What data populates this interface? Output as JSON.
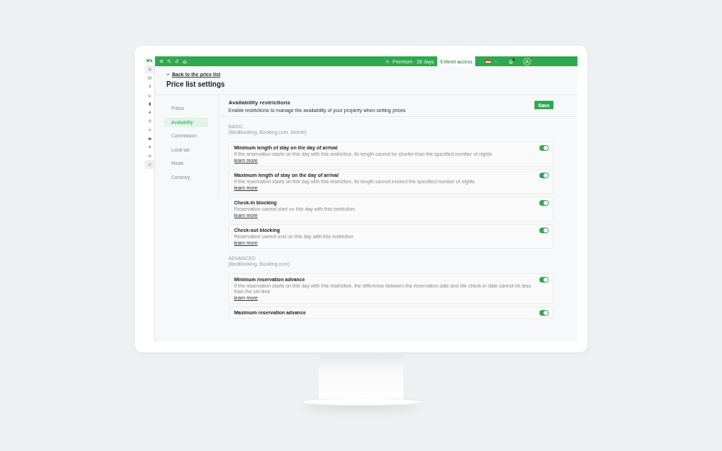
{
  "rail": {
    "items": [
      {
        "selected": true
      },
      {
        "selected": false
      },
      {
        "selected": false
      },
      {
        "selected": false
      },
      {
        "selected": false
      },
      {
        "selected": false
      },
      {
        "selected": false
      },
      {
        "selected": false
      },
      {
        "selected": false
      },
      {
        "selected": false
      },
      {
        "selected": false
      },
      {
        "selected": true
      }
    ]
  },
  "topbar": {
    "premium": "Premium · 28 days",
    "extend_button": "Extend access",
    "avatar": "A"
  },
  "header": {
    "back_link": "Back to the price list",
    "title": "Price list settings"
  },
  "nav": [
    {
      "label": "Prices",
      "selected": false
    },
    {
      "label": "Availability",
      "selected": true
    },
    {
      "label": "Commission",
      "selected": false
    },
    {
      "label": "Local tax",
      "selected": false
    },
    {
      "label": "Meals",
      "selected": false
    },
    {
      "label": "Currency",
      "selected": false
    }
  ],
  "panel": {
    "title": "Availability restrictions",
    "subtitle": "Enable restrictions to manage the availability of your property when setting prices",
    "save_button": "Save"
  },
  "groups": [
    {
      "heading": "BASIC",
      "channels": "(BedBooking, Booking.com, Airbnb)",
      "restrictions": [
        {
          "title": "Minimum length of stay on the day of arrival",
          "description": "If the reservation starts on this day with this restriction, its length cannot be shorter than the specified number of nights",
          "link": "learn more",
          "on": true
        },
        {
          "title": "Maximum length of stay on the day of arrival",
          "description": "If the reservation starts on this day with this restriction, its length cannot exceed the specified number of nights",
          "link": "learn more",
          "on": true
        },
        {
          "title": "Check-in blocking",
          "description": "Reservation cannot start on this day with this restriction",
          "link": "learn more",
          "on": true
        },
        {
          "title": "Check-out blocking",
          "description": "Reservation cannot end on this day with this restriction",
          "link": "learn more",
          "on": true
        }
      ]
    },
    {
      "heading": "ADVANCED",
      "channels": "(BedBooking, Booking.com)",
      "restrictions": [
        {
          "title": "Minimum reservation advance",
          "description": "If the reservation starts on this day with this restriction, the difference between the reservation date and the check-in date cannot be less than the set time",
          "link": "learn more",
          "on": true
        },
        {
          "title": "Maximum reservation advance",
          "on": true
        }
      ]
    }
  ]
}
